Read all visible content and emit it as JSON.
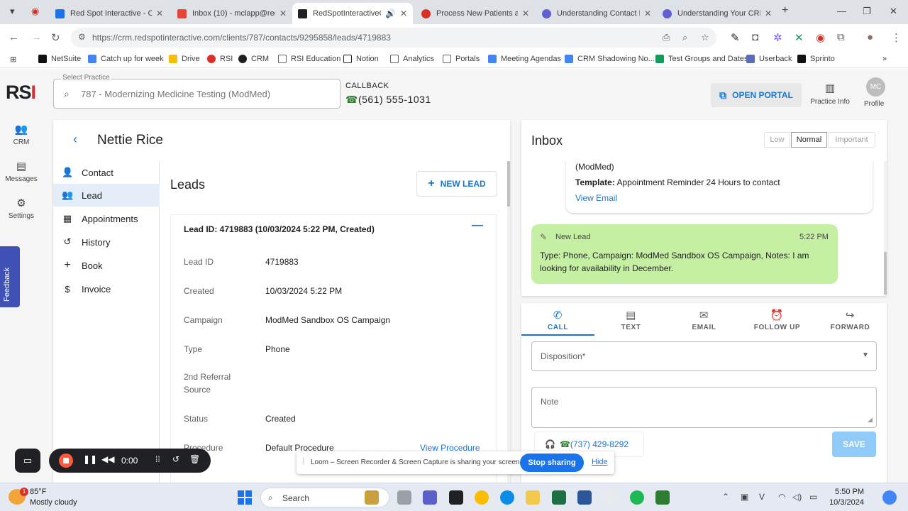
{
  "browser": {
    "tabs": [
      {
        "label": "Red Spot Interactive - Ca",
        "color": "#1a73e8"
      },
      {
        "label": "Inbox (10) - mclapp@red",
        "color": "#ea4335"
      },
      {
        "label": "RedSpotInteractiveCR",
        "color": "#202124"
      },
      {
        "label": "Process New Patients an",
        "color": "#d93025"
      },
      {
        "label": "Understanding Contact P",
        "color": "#5f5fd6"
      },
      {
        "label": "Understanding Your CRM",
        "color": "#5f5fd6"
      }
    ],
    "url": "https://crm.redspotinteractive.com/clients/787/contacts/9295858/leads/4719883",
    "bookmarks": [
      "NetSuite",
      "Catch up for week",
      "Drive",
      "RSI",
      "CRM",
      "RSI Education",
      "Notion",
      "Analytics",
      "Portals",
      "Meeting Agendas",
      "CRM Shadowing No...",
      "Test Groups and Dates",
      "Userback",
      "Sprinto"
    ]
  },
  "app": {
    "logo": {
      "main": "RS",
      "accent": "I"
    },
    "rail": [
      {
        "label": "CRM",
        "icon": "users-icon"
      },
      {
        "label": "Messages",
        "icon": "message-icon"
      },
      {
        "label": "Settings",
        "icon": "gear-icon"
      }
    ],
    "feedback_label": "Feedback",
    "practice": {
      "label": "Select Practice",
      "value": "787 - Modernizing Medicine Testing (ModMed)"
    },
    "callback": {
      "label": "CALLBACK",
      "phone": "(561) 555-1031"
    },
    "open_portal_label": "OPEN PORTAL",
    "practice_info_label": "Practice Info",
    "profile": {
      "initials": "MC",
      "label": "Profile"
    },
    "contact_name": "Nettie Rice",
    "left_nav": [
      {
        "label": "Contact",
        "icon": "person-icon"
      },
      {
        "label": "Lead",
        "icon": "group-icon"
      },
      {
        "label": "Appointments",
        "icon": "calendar-icon"
      },
      {
        "label": "History",
        "icon": "history-icon"
      },
      {
        "label": "Book",
        "icon": "plus-icon"
      },
      {
        "label": "Invoice",
        "icon": "dollar-icon"
      }
    ],
    "leads": {
      "title": "Leads",
      "new_lead_label": "NEW LEAD",
      "header": "Lead ID: 4719883 (10/03/2024 5:22 PM, Created)",
      "fields": [
        {
          "label": "Lead ID",
          "value": "4719883"
        },
        {
          "label": "Created",
          "value": "10/03/2024 5:22 PM"
        },
        {
          "label": "Campaign",
          "value": "ModMed Sandbox OS Campaign"
        },
        {
          "label": "Type",
          "value": "Phone"
        },
        {
          "label": "2nd Referral Source",
          "value": ""
        },
        {
          "label": "Status",
          "value": "Created"
        },
        {
          "label": "Procedure",
          "value": "Default Procedure"
        }
      ],
      "view_procedure_label": "View Procedure"
    },
    "inbox": {
      "title": "Inbox",
      "priorities": [
        "Low",
        "Normal",
        "Important"
      ],
      "selected_priority": "Normal",
      "prev_message": {
        "line1": "(ModMed)",
        "template_label": "Template:",
        "template_value": "Appointment Reminder 24 Hours to contact",
        "link": "View Email"
      },
      "new_message": {
        "title": "New Lead",
        "time": "5:22 PM",
        "body": "Type: Phone, Campaign: ModMed Sandbox OS Campaign, Notes: I am looking for availability in December."
      }
    },
    "actions": {
      "tabs": [
        {
          "label": "CALL",
          "icon": "phone-icon"
        },
        {
          "label": "TEXT",
          "icon": "chat-icon"
        },
        {
          "label": "EMAIL",
          "icon": "mail-icon"
        },
        {
          "label": "FOLLOW UP",
          "icon": "alarm-icon"
        },
        {
          "label": "FORWARD",
          "icon": "forward-icon"
        }
      ],
      "disposition_label": "Disposition*",
      "note_label": "Note",
      "phone": "(737) 429-8292",
      "save_label": "SAVE"
    }
  },
  "loom": {
    "timer": "0:00",
    "share_text": "Loom – Screen Recorder & Screen Capture is sharing your screen.",
    "stop_label": "Stop sharing",
    "hide_label": "Hide"
  },
  "taskbar": {
    "weather_badge": "1",
    "temp": "85°F",
    "weather": "Mostly cloudy",
    "search_label": "Search",
    "time": "5:50 PM",
    "date": "10/3/2024"
  }
}
